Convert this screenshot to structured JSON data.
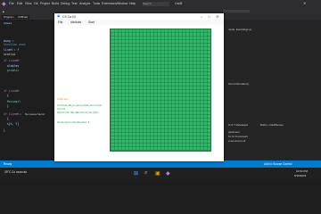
{
  "ide": {
    "menu": [
      "File",
      "Edit",
      "View",
      "Git",
      "Project",
      "Build",
      "Debug",
      "Test",
      "Analyze",
      "Tools",
      "Extensions",
      "Window",
      "Help"
    ],
    "search": "Search",
    "title": "Ca08",
    "tab": "Program",
    "file_tab": "C08Ca0",
    "breadcrumb": "Class1",
    "code_lines": [
      "dung = ",
      "Sunction even",
      "lineH = f",
      "stat(mi",
      "if (LineH",
      "  oldplay",
      "  graphic",
      "if (LineH",
      "  {",
      "  Messagel",
      "  }",
      "if (LineH",
      "  {",
      "  s[X, Y]",
      "}"
    ],
    "right_snippets": [
      "Icon.Information);",
      "parameter",
      "for int Framework",
      "a document roll"
    ],
    "right_top": "nsole, EventArgs e)",
    "issues": "No issues found",
    "messages": "0 of 7 Messages",
    "build": "Build + IntelliSense",
    "status_ready": "Ready",
    "status_right": "Add to Source Control",
    "taskbar_weather": "29°C  Có mưa rào",
    "taskbar_time": "10:54 PM",
    "taskbar_date": "6/10/2023"
  },
  "window": {
    "title": "CS Ca 03",
    "menu": [
      "File",
      "Attribute",
      "Start"
    ],
    "label_title": "Nhập liệu",
    "label_1": "Có lẽ bạn đã gọi game thuận và có cuộn chơi 01",
    "label_2": "Người chơi dẫn đầu tính với sẽ 2 tiền",
    "label_3": "Ghi là người chơi đạt được 3"
  },
  "colors": {
    "grid_green": "#2fb86b",
    "accent_blue": "#007acc"
  }
}
